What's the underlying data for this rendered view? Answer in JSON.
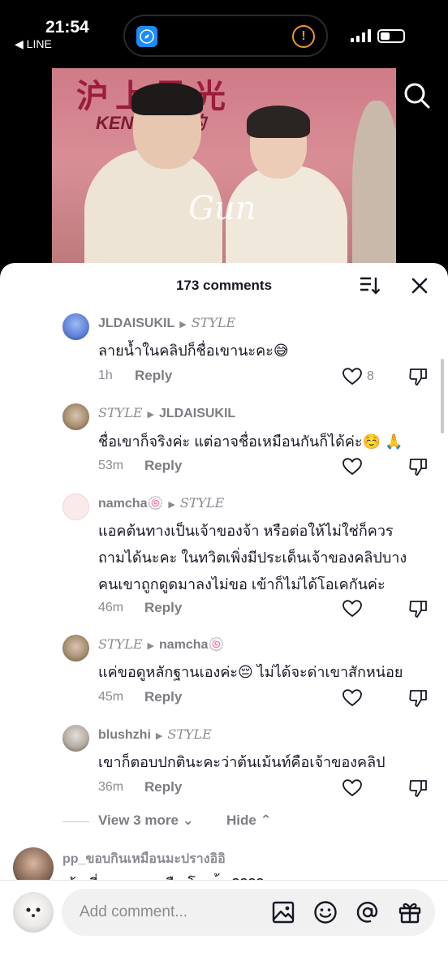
{
  "status_bar": {
    "time": "21:54",
    "back_app": "◀ LINE"
  },
  "video": {
    "banner_title": "沪上星光",
    "banner_subtitle": "KEN… ING的",
    "watermark": "Gun"
  },
  "sheet": {
    "comment_count": "173 comments",
    "comments": [
      {
        "user": "JLDAISUKIL",
        "reply_to": "STYLE",
        "text": "ลายน้ำในคลิปก็ชื่อเขานะคะ😅",
        "time": "1h",
        "reply": "Reply",
        "likes": "8"
      },
      {
        "user": "STYLE",
        "reply_to": "JLDAISUKIL",
        "text": "ชื่อเขาก็จริงค่ะ แต่อาจชื่อเหมือนกันก็ได้ค่ะ☺️ 🙏",
        "time": "53m",
        "reply": "Reply",
        "likes": ""
      },
      {
        "user": "namcha🍥",
        "reply_to": "STYLE",
        "text_lines": [
          "แอคต้นทางเป็นเจ้าของจ้า หรือต่อให้ไม่ใช่ก็ควร",
          "ถามได้นะคะ ในทวิตเพิ่งมีประเด็นเจ้าของคลิปบาง",
          "คนเขาถูกดูดมาลงไม่ขอ เข้าก็ไม่ได้โอเคกันค่ะ"
        ],
        "time": "46m",
        "reply": "Reply",
        "likes": ""
      },
      {
        "user": "STYLE",
        "reply_to": "namcha🍥",
        "text": "แค่ขอดูหลักฐานเองค่ะ😔 ไม่ได้จะด่าเขาสักหน่อย",
        "time": "45m",
        "reply": "Reply",
        "likes": ""
      },
      {
        "user": "blushzhi",
        "reply_to": "STYLE",
        "text": "เขาก็ตอบปกตินะคะว่าต้นเม้นท์คือเจ้าของคลิป",
        "time": "36m",
        "reply": "Reply",
        "likes": ""
      }
    ],
    "view_more": "View 3 more ⌄",
    "hide": "Hide ⌃",
    "partial": {
      "user": "pp_ขอบกินเหมือนมะปรางอิอิ",
      "text": "เจ้า ที่ …  …ง  … ลืม โ …  ้า  ????"
    }
  },
  "bottom_bar": {
    "placeholder": "Add comment..."
  },
  "colors": {
    "accent_text": "#161823",
    "secondary_text": "#8a8b91",
    "sheet_bg": "#ffffff",
    "input_bg": "#f1f1f2"
  },
  "icons": [
    "safari-icon",
    "warning-icon",
    "signal-icon",
    "battery-icon",
    "search-icon",
    "sort-icon",
    "close-icon",
    "heart-icon",
    "dislike-icon",
    "image-icon",
    "emoji-icon",
    "mention-icon",
    "gift-icon"
  ]
}
